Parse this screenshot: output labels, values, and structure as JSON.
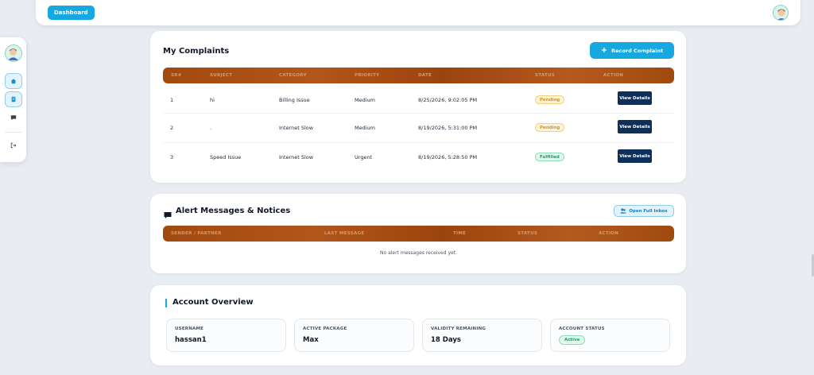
{
  "topbar": {
    "dashboard_label": "Dashboard"
  },
  "icons": {
    "home": "home-icon",
    "complaints": "document-icon",
    "messages": "chat-icon",
    "logout": "logout-icon"
  },
  "colors": {
    "accent": "#17a8e0",
    "header": "#a14a0f",
    "navy": "#0e2f5a"
  },
  "complaints": {
    "title": "My Complaints",
    "record_label": "Record Complaint",
    "columns": [
      "SR#",
      "SUBJECT",
      "CATEGORY",
      "PRIORITY",
      "DATE",
      "STATUS",
      "ACTION"
    ],
    "rows": [
      {
        "sr": "1",
        "subject": "hi",
        "category": "Billing Issue",
        "priority": "Medium",
        "date": "8/25/2026, 9:02:05 PM",
        "status": "Pending",
        "action": "View Details"
      },
      {
        "sr": "2",
        "subject": ".",
        "category": "Internet Slow",
        "priority": "Medium",
        "date": "8/19/2026, 5:31:00 PM",
        "status": "Pending",
        "action": "View Details"
      },
      {
        "sr": "3",
        "subject": "Speed Issue",
        "category": "Internet Slow",
        "priority": "Urgent",
        "date": "8/19/2026, 5:28:50 PM",
        "status": "Fulfilled",
        "action": "View Details"
      }
    ]
  },
  "alerts": {
    "title": "Alert Messages & Notices",
    "inbox_label": "Open Full Inbox",
    "columns": [
      "SENDER / PARTNER",
      "LAST MESSAGE",
      "TIME",
      "STATUS",
      "ACTION"
    ],
    "empty": "No alert messages received yet."
  },
  "account": {
    "title": "Account Overview",
    "stats": [
      {
        "label": "USERNAME",
        "value": "hassan1"
      },
      {
        "label": "ACTIVE PACKAGE",
        "value": "Max"
      },
      {
        "label": "VALIDITY REMAINING",
        "value": "18 Days"
      },
      {
        "label": "ACCOUNT STATUS",
        "value": "Active"
      }
    ]
  }
}
